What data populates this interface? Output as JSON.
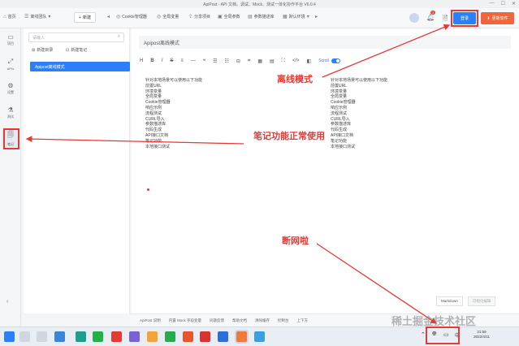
{
  "window": {
    "title": "ApiPost - API 文档、调试、Mock、测试一体化协作平台 V6.0.4"
  },
  "toolbar": {
    "home": "首页",
    "team": "离线团队",
    "new": "新建",
    "tabs": [
      "Cookie管理器",
      "全局变量",
      "分享项目",
      "全局参数",
      "参数描述库",
      "默认环境"
    ]
  },
  "header_right": {
    "badge_count": "1",
    "login_label": "登录",
    "download_label": "更新软件"
  },
  "leftnav": {
    "items": [
      {
        "label": "项目",
        "icon": "folder-icon"
      },
      {
        "label": "APIs",
        "icon": "api-icon"
      },
      {
        "label": "设置",
        "icon": "gear-icon"
      },
      {
        "label": "测试",
        "icon": "test-icon"
      },
      {
        "label": "笔记",
        "icon": "note-icon"
      }
    ]
  },
  "notes_panel": {
    "search_placeholder": "请输入",
    "new_folder": "新建目录",
    "new_note": "新建笔记",
    "selected_note": "Apipost离线模式"
  },
  "editor": {
    "title": "Apipost离线模式",
    "toolbar": [
      "H",
      "B",
      "I",
      "S",
      "≡",
      "—",
      "❝",
      "☰",
      "☷",
      "⊟",
      "⌗",
      "▦",
      "▤",
      "⛶",
      "</>",
      "◧"
    ],
    "scroll_label": "Scroll",
    "lines": [
      "针对本地场景可以使用以下功能",
      "前置URL",
      "环境变量",
      "全局变量",
      "Cookie管理器",
      "响应示例",
      "流程测试",
      "CURL导入",
      "参数描述库",
      "代码生成",
      "API接口文档",
      "笔记功能",
      "本地接口测试"
    ],
    "preview_lines": [
      "针对本地场景可以使用以下功能",
      "前置URL",
      "环境变量",
      "全局变量",
      "Cookie管理器",
      "响应示例",
      "流程测试",
      "CURL导入",
      "参数描述库",
      "代码生成",
      "API接口文档",
      "笔记功能",
      "本地接口测试"
    ],
    "mode_tabs": [
      "Markdown",
      "可视化编辑"
    ]
  },
  "annotations": {
    "offline_mode": "离线模式",
    "notes_ok": "笔记功能正常使用",
    "disconnected": "断网啦"
  },
  "statusbar": {
    "items": [
      "ApiPost 说明",
      "内置 Mock 字段变量",
      "问题反馈",
      "帮助文档",
      "清除缓存",
      "控制台",
      "上下方"
    ]
  },
  "taskbar": {
    "time": "21:59",
    "date": "2022/4/11",
    "lang": "中"
  },
  "watermark": "稀土掘金技术社区"
}
